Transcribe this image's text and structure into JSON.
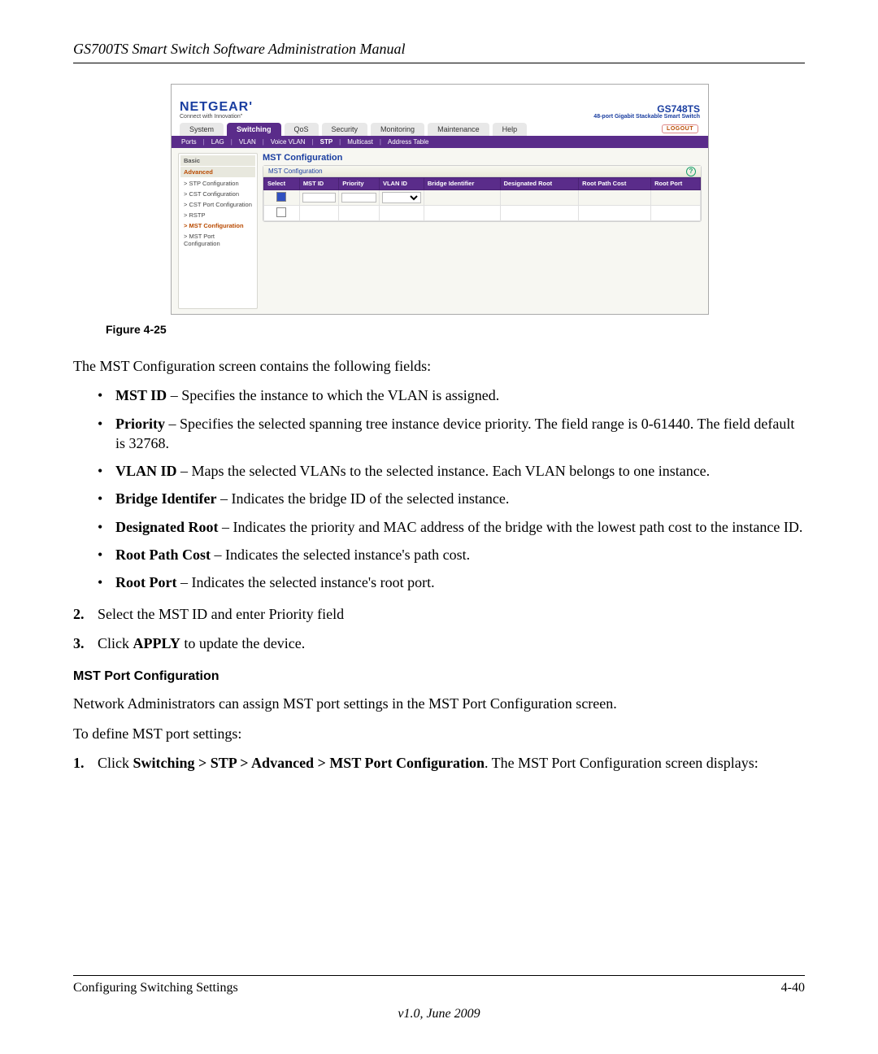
{
  "doc": {
    "header": "GS700TS Smart Switch Software Administration Manual",
    "figure_caption": "Figure 4-25",
    "intro": "The MST Configuration screen contains the following fields:",
    "bullets": [
      {
        "term": "MST ID",
        "desc": " – Specifies the instance to which the VLAN is assigned."
      },
      {
        "term": "Priority",
        "desc": " – Specifies the selected spanning tree instance device priority. The field range is 0-61440. The field default is 32768."
      },
      {
        "term": "VLAN ID",
        "desc": " – Maps the selected VLANs to the selected instance. Each VLAN belongs to one instance."
      },
      {
        "term": "Bridge Identifer",
        "desc": " – Indicates the bridge ID of the selected instance."
      },
      {
        "term": "Designated Root",
        "desc": " – Indicates the priority and MAC address of the bridge with the lowest path cost to the instance ID."
      },
      {
        "term": "Root Path Cost",
        "desc": " – Indicates the selected instance's path cost."
      },
      {
        "term": "Root Port",
        "desc": " – Indicates the selected instance's root port."
      }
    ],
    "steps": [
      {
        "num": "2.",
        "text": "Select the MST ID and enter Priority field"
      },
      {
        "num": "3.",
        "pre": "Click ",
        "bold": "APPLY",
        "post": " to update the device."
      }
    ],
    "subheading": "MST Port Configuration",
    "sub_p1": "Network Administrators can assign MST port settings in the MST Port Configuration screen.",
    "sub_p2": "To define MST port settings:",
    "sub_step": {
      "num": "1.",
      "pre": "Click ",
      "bold": "Switching > STP > Advanced > MST Port Configuration",
      "post": ". The MST Port Configuration screen displays:"
    },
    "footer_left": "Configuring Switching Settings",
    "footer_right": "4-40",
    "footer_sub": "v1.0, June 2009"
  },
  "shot": {
    "logo": "NETGEAR",
    "logo_dot": "'",
    "tagline": "Connect with Innovation\"",
    "product": "GS748TS",
    "product_sub": "48-port Gigabit Stackable Smart Switch",
    "tabs": [
      "System",
      "Switching",
      "QoS",
      "Security",
      "Monitoring",
      "Maintenance",
      "Help"
    ],
    "active_tab": 1,
    "logout": "LOGOUT",
    "subnav": [
      "Ports",
      "LAG",
      "VLAN",
      "Voice VLAN",
      "STP",
      "Multicast",
      "Address Table"
    ],
    "subnav_active": 4,
    "side": {
      "basic": "Basic",
      "advanced": "Advanced",
      "items": [
        "STP Configuration",
        "CST Configuration",
        "CST Port Configuration",
        "RSTP",
        "MST Configuration",
        "MST Port Configuration"
      ],
      "active_item": 4
    },
    "main_title": "MST Configuration",
    "panel_title": "MST Configuration",
    "columns": [
      "Select",
      "MST ID",
      "Priority",
      "VLAN ID",
      "Bridge Identifier",
      "Designated Root",
      "Root Path Cost",
      "Root Port"
    ],
    "help_mark": "?"
  }
}
